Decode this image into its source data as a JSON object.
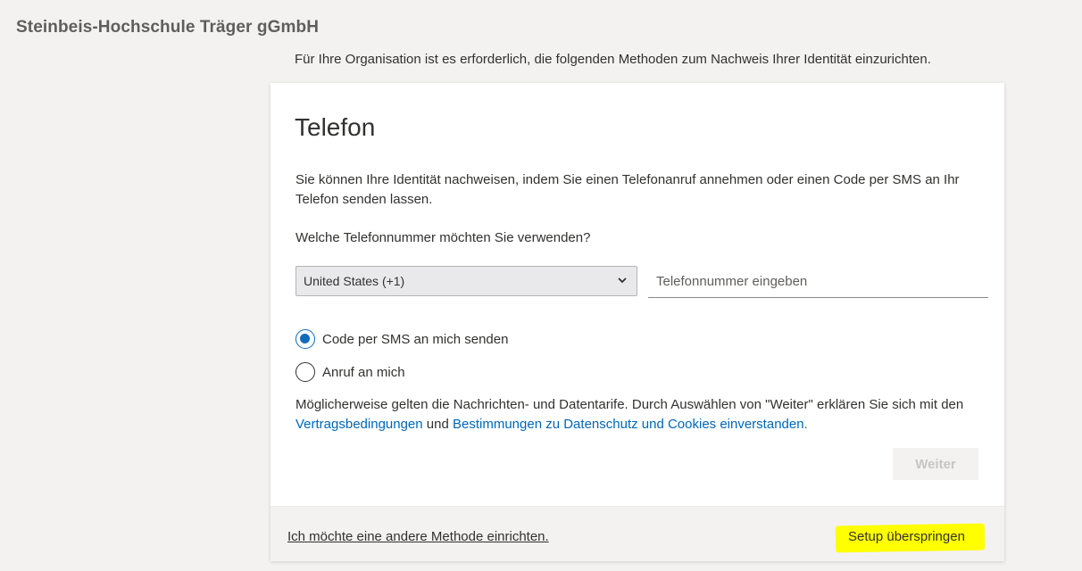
{
  "header": {
    "org_name": "Steinbeis-Hochschule Träger gGmbH"
  },
  "intro_text": "Für Ihre Organisation ist es erforderlich, die folgenden Methoden zum Nachweis Ihrer Identität einzurichten.",
  "card": {
    "title": "Telefon",
    "description": "Sie können Ihre Identität nachweisen, indem Sie einen Telefonanruf annehmen oder einen Code per SMS an Ihr Telefon senden lassen.",
    "question": "Welche Telefonnummer möchten Sie verwenden?",
    "country_select": {
      "selected": "United States (+1)",
      "icon": "chevron-down-icon"
    },
    "phone_input": {
      "value": "",
      "placeholder": "Telefonnummer eingeben"
    },
    "options": [
      {
        "label": "Code per SMS an mich senden",
        "checked": true
      },
      {
        "label": "Anruf an mich",
        "checked": false
      }
    ],
    "legal": {
      "prefix": "Möglicherweise gelten die Nachrichten- und Datentarife. Durch Auswählen von \"Weiter\" erklären Sie sich mit den ",
      "terms_link": "Vertragsbedingungen",
      "middle": " und ",
      "privacy_link": "Bestimmungen zu Datenschutz und Cookies einverstanden."
    },
    "next_button": "Weiter",
    "next_disabled": true
  },
  "footer": {
    "other_method_link": "Ich möchte eine andere Methode einrichten.",
    "skip_link": "Setup überspringen",
    "highlight_color": "#ffff00"
  },
  "colors": {
    "accent": "#0f6cbd",
    "link": "#0067b8",
    "background": "#f3f2f1"
  }
}
